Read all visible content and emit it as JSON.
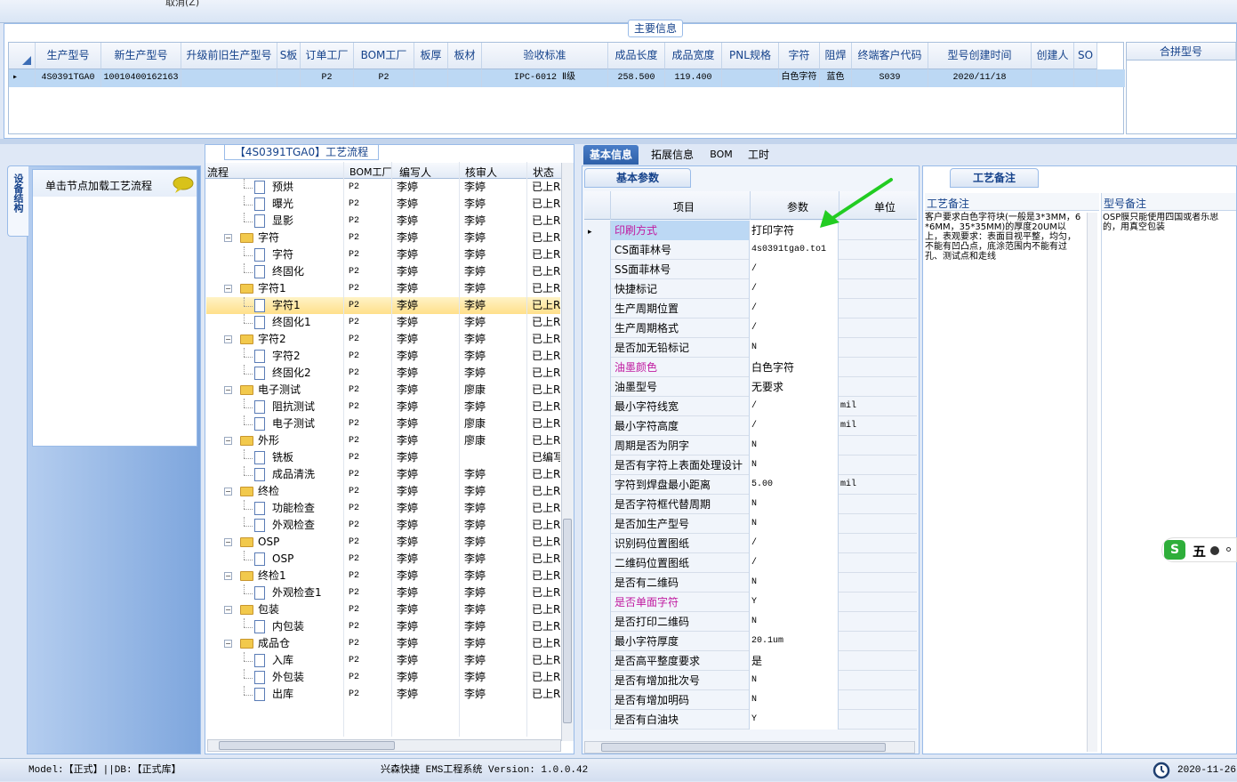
{
  "top": {
    "cancel_label": "取消(Z)"
  },
  "main_section": {
    "title": "主要信息",
    "columns": [
      "生产型号",
      "新生产型号",
      "升级前旧生产型号",
      "S板",
      "订单工厂",
      "BOM工厂",
      "板厚",
      "板材",
      "验收标准",
      "成品长度",
      "成品宽度",
      "PNL规格",
      "字符",
      "阻焊",
      "终端客户代码",
      "型号创建时间",
      "创建人",
      "SO"
    ],
    "row": [
      "4S0391TGA0",
      "10010400162163",
      "",
      "",
      "P2",
      "P2",
      "",
      "",
      "IPC-6012 Ⅱ级",
      "258.500",
      "119.400",
      "",
      "白色字符",
      "蓝色",
      "S039",
      "2020/11/18",
      "",
      ""
    ],
    "merge_header": "合拼型号"
  },
  "left": {
    "vertical_tab": "设备结构",
    "load_tip": "单击节点加载工艺流程"
  },
  "tree": {
    "title": "【4S0391TGA0】工艺流程",
    "headers": [
      "流程",
      "BOM工厂",
      "编写人",
      "核审人",
      "状态"
    ],
    "rows": [
      {
        "name": "预烘",
        "bom": "P2",
        "writer": "李婷",
        "reviewer": "李婷",
        "status": "已上R"
      },
      {
        "name": "曝光",
        "bom": "P2",
        "writer": "李婷",
        "reviewer": "李婷",
        "status": "已上R"
      },
      {
        "name": "显影",
        "bom": "P2",
        "writer": "李婷",
        "reviewer": "李婷",
        "status": "已上R"
      },
      {
        "name": "字符",
        "bom": "P2",
        "writer": "李婷",
        "reviewer": "李婷",
        "status": "已上R"
      },
      {
        "name": "字符",
        "bom": "P2",
        "writer": "李婷",
        "reviewer": "李婷",
        "status": "已上R"
      },
      {
        "name": "终固化",
        "bom": "P2",
        "writer": "李婷",
        "reviewer": "李婷",
        "status": "已上R"
      },
      {
        "name": "字符1",
        "bom": "P2",
        "writer": "李婷",
        "reviewer": "李婷",
        "status": "已上R"
      },
      {
        "name": "字符1",
        "bom": "P2",
        "writer": "李婷",
        "reviewer": "李婷",
        "status": "已上R"
      },
      {
        "name": "终固化1",
        "bom": "P2",
        "writer": "李婷",
        "reviewer": "李婷",
        "status": "已上R"
      },
      {
        "name": "字符2",
        "bom": "P2",
        "writer": "李婷",
        "reviewer": "李婷",
        "status": "已上R"
      },
      {
        "name": "字符2",
        "bom": "P2",
        "writer": "李婷",
        "reviewer": "李婷",
        "status": "已上R"
      },
      {
        "name": "终固化2",
        "bom": "P2",
        "writer": "李婷",
        "reviewer": "李婷",
        "status": "已上R"
      },
      {
        "name": "电子测试",
        "bom": "P2",
        "writer": "李婷",
        "reviewer": "廖康",
        "status": "已上R"
      },
      {
        "name": "阻抗测试",
        "bom": "P2",
        "writer": "李婷",
        "reviewer": "李婷",
        "status": "已上R"
      },
      {
        "name": "电子测试",
        "bom": "P2",
        "writer": "李婷",
        "reviewer": "廖康",
        "status": "已上R"
      },
      {
        "name": "外形",
        "bom": "P2",
        "writer": "李婷",
        "reviewer": "廖康",
        "status": "已上R"
      },
      {
        "name": "铣板",
        "bom": "P2",
        "writer": "李婷",
        "reviewer": "",
        "status": "已编写"
      },
      {
        "name": "成品清洗",
        "bom": "P2",
        "writer": "李婷",
        "reviewer": "李婷",
        "status": "已上R"
      },
      {
        "name": "终检",
        "bom": "P2",
        "writer": "李婷",
        "reviewer": "李婷",
        "status": "已上R"
      },
      {
        "name": "功能检查",
        "bom": "P2",
        "writer": "李婷",
        "reviewer": "李婷",
        "status": "已上R"
      },
      {
        "name": "外观检查",
        "bom": "P2",
        "writer": "李婷",
        "reviewer": "李婷",
        "status": "已上R"
      },
      {
        "name": "OSP",
        "bom": "P2",
        "writer": "李婷",
        "reviewer": "李婷",
        "status": "已上R"
      },
      {
        "name": "OSP",
        "bom": "P2",
        "writer": "李婷",
        "reviewer": "李婷",
        "status": "已上R"
      },
      {
        "name": "终检1",
        "bom": "P2",
        "writer": "李婷",
        "reviewer": "李婷",
        "status": "已上R"
      },
      {
        "name": "外观检查1",
        "bom": "P2",
        "writer": "李婷",
        "reviewer": "李婷",
        "status": "已上R"
      },
      {
        "name": "包装",
        "bom": "P2",
        "writer": "李婷",
        "reviewer": "李婷",
        "status": "已上R"
      },
      {
        "name": "内包装",
        "bom": "P2",
        "writer": "李婷",
        "reviewer": "李婷",
        "status": "已上R"
      },
      {
        "name": "成品仓",
        "bom": "P2",
        "writer": "李婷",
        "reviewer": "李婷",
        "status": "已上R"
      },
      {
        "name": "入库",
        "bom": "P2",
        "writer": "李婷",
        "reviewer": "李婷",
        "status": "已上R"
      },
      {
        "name": "外包装",
        "bom": "P2",
        "writer": "李婷",
        "reviewer": "李婷",
        "status": "已上R"
      },
      {
        "name": "出库",
        "bom": "P2",
        "writer": "李婷",
        "reviewer": "李婷",
        "status": "已上R"
      }
    ]
  },
  "tabs": [
    "基本信息",
    "拓展信息",
    "BOM",
    "工时"
  ],
  "props": {
    "subtab": "基本参数",
    "headers": [
      "项目",
      "参数",
      "单位"
    ],
    "rows": [
      {
        "item": "印刷方式",
        "value": "打印字符",
        "unit": ""
      },
      {
        "item": "CS面菲林号",
        "value": "4s0391tga0.to1",
        "unit": ""
      },
      {
        "item": "SS面菲林号",
        "value": "/",
        "unit": ""
      },
      {
        "item": "快捷标记",
        "value": "/",
        "unit": ""
      },
      {
        "item": "生产周期位置",
        "value": "/",
        "unit": ""
      },
      {
        "item": "生产周期格式",
        "value": "/",
        "unit": ""
      },
      {
        "item": "是否加无铅标记",
        "value": "N",
        "unit": ""
      },
      {
        "item": "油墨颜色",
        "value": "白色字符",
        "unit": ""
      },
      {
        "item": "油墨型号",
        "value": "无要求",
        "unit": ""
      },
      {
        "item": "最小字符线宽",
        "value": "/",
        "unit": "mil"
      },
      {
        "item": "最小字符高度",
        "value": "/",
        "unit": "mil"
      },
      {
        "item": "周期是否为阴字",
        "value": "N",
        "unit": ""
      },
      {
        "item": "是否有字符上表面处理设计",
        "value": "N",
        "unit": ""
      },
      {
        "item": "字符到焊盘最小距离",
        "value": "5.00",
        "unit": "mil"
      },
      {
        "item": "是否字符框代替周期",
        "value": "N",
        "unit": ""
      },
      {
        "item": "是否加生产型号",
        "value": "N",
        "unit": ""
      },
      {
        "item": "识别码位置图纸",
        "value": "/",
        "unit": ""
      },
      {
        "item": "二维码位置图纸",
        "value": "/",
        "unit": ""
      },
      {
        "item": "是否有二维码",
        "value": "N",
        "unit": ""
      },
      {
        "item": "是否单面字符",
        "value": "Y",
        "unit": ""
      },
      {
        "item": "是否打印二维码",
        "value": "N",
        "unit": ""
      },
      {
        "item": "最小字符厚度",
        "value": "20.1um",
        "unit": ""
      },
      {
        "item": "是否高平整度要求",
        "value": "是",
        "unit": ""
      },
      {
        "item": "是否有增加批次号",
        "value": "N",
        "unit": ""
      },
      {
        "item": "是否有增加明码",
        "value": "N",
        "unit": ""
      },
      {
        "item": "是否有白油块",
        "value": "Y",
        "unit": ""
      }
    ]
  },
  "notes": {
    "tab": "工艺备注",
    "process_note_label": "工艺备注",
    "process_note": "客户要求白色字符块(一般是3*3MM，6*6MM，35*35MM)的厚度20UM以上，表观要求：表面目视平整，均匀，不能有凹凸点，底涂范围内不能有过孔、测试点和走线",
    "model_note_label": "型号备注",
    "model_note": "OSP膜只能使用四国或者乐思的，用真空包装"
  },
  "ime": {
    "label": "五"
  },
  "status": {
    "left": "Model:【正式】||DB:【正式库】",
    "center": "兴森快捷 EMS工程系统 Version: 1.0.0.42",
    "date": "2020-11-26"
  },
  "colors": {
    "accent": "#15428b",
    "highlight_label": "#c01aa0",
    "arrow": "#22cc22"
  }
}
